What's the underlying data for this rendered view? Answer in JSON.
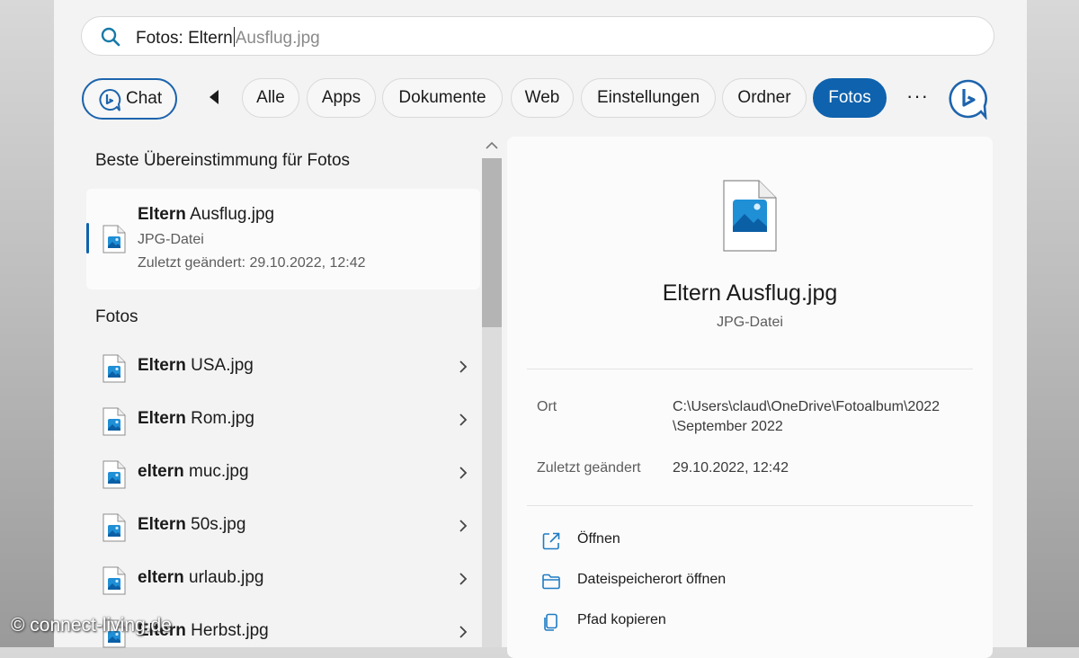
{
  "search": {
    "typed": "Fotos: Eltern",
    "suggestion": "Ausflug.jpg"
  },
  "filters": {
    "chat": "Chat",
    "items": [
      "Alle",
      "Apps",
      "Dokumente",
      "Web",
      "Einstellungen",
      "Ordner",
      "Fotos"
    ],
    "active": "Fotos",
    "more": "···"
  },
  "best_match": {
    "heading": "Beste Übereinstimmung für Fotos",
    "name_bold": "Eltern",
    "name_rest": " Ausflug.jpg",
    "type": "JPG-Datei",
    "modified": "Zuletzt geändert: 29.10.2022, 12:42"
  },
  "photos": {
    "heading": "Fotos",
    "items": [
      {
        "bold": "Eltern",
        "rest": " USA.jpg"
      },
      {
        "bold": "Eltern",
        "rest": " Rom.jpg"
      },
      {
        "bold": "eltern",
        "rest": " muc.jpg"
      },
      {
        "bold": "Eltern",
        "rest": " 50s.jpg"
      },
      {
        "bold": "eltern",
        "rest": " urlaub.jpg"
      },
      {
        "bold": "Eltern",
        "rest": " Herbst.jpg"
      }
    ]
  },
  "detail": {
    "title": "Eltern Ausflug.jpg",
    "type": "JPG-Datei",
    "location_label": "Ort",
    "location_line1": "C:\\Users\\claud\\OneDrive\\Fotoalbum\\2022",
    "location_line2": "\\September 2022",
    "modified_label": "Zuletzt geändert",
    "modified_value": "29.10.2022, 12:42",
    "actions": [
      "Öffnen",
      "Dateispeicherort öffnen",
      "Pfad kopieren"
    ]
  },
  "watermark": "© connect-living.de",
  "colors": {
    "accent": "#0f62ad",
    "panel": "#f3f3f3"
  }
}
